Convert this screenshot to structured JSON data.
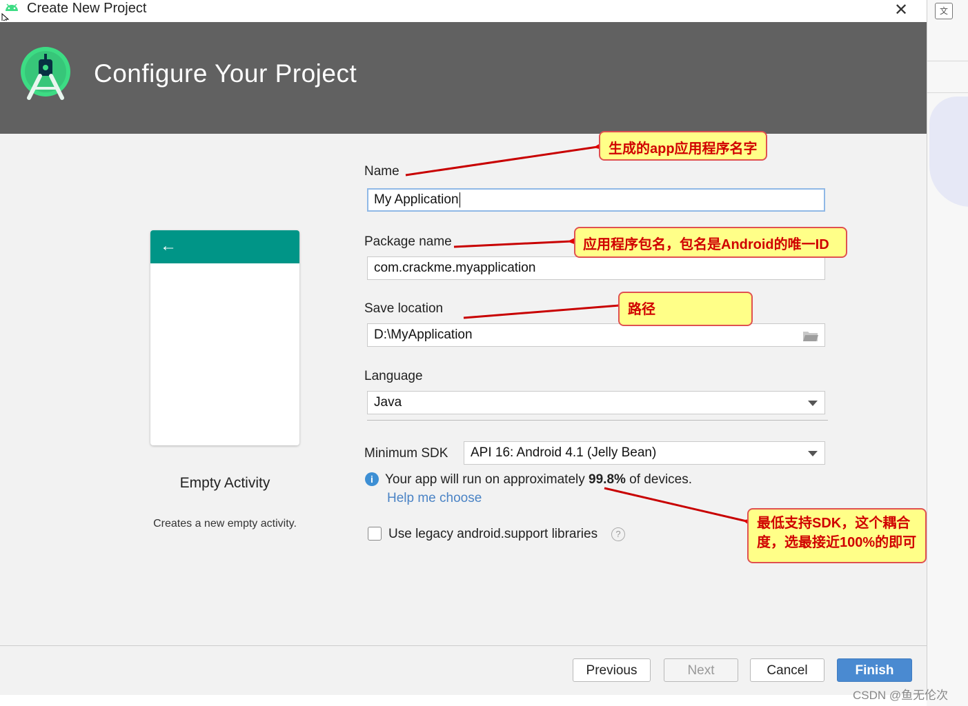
{
  "window": {
    "title": "Create New Project",
    "close_glyph": "✕"
  },
  "header": {
    "heading": "Configure Your Project"
  },
  "template": {
    "back_glyph": "←",
    "name": "Empty Activity",
    "description": "Creates a new empty activity."
  },
  "form": {
    "name_label": "Name",
    "name_value": "My Application",
    "package_label": "Package name",
    "package_value": "com.crackme.myapplication",
    "save_label": "Save location",
    "save_value": "D:\\MyApplication",
    "language_label": "Language",
    "language_value": "Java",
    "min_sdk_label": "Minimum SDK",
    "min_sdk_value": "API 16: Android 4.1 (Jelly Bean)",
    "info_prefix": "Your app will run on approximately ",
    "info_percent": "99.8%",
    "info_suffix": " of devices.",
    "help_link": "Help me choose",
    "legacy_label": "Use legacy android.support libraries",
    "legacy_checked": false,
    "help_glyph": "?"
  },
  "footer": {
    "previous": "Previous",
    "next": "Next",
    "cancel": "Cancel",
    "finish": "Finish"
  },
  "annotations": {
    "name_note": "生成的app应用程序名字",
    "package_note": "应用程序包名，包名是Android的唯一ID",
    "path_note": "路径",
    "sdk_note_line1": "最低支持SDK，这个耦合",
    "sdk_note_line2": "度，选最接近100%的即可"
  },
  "watermark": "CSDN @鱼无伦次",
  "colors": {
    "header_bg": "#616161",
    "toolbar_teal": "#009587",
    "primary_button": "#4a8ad1",
    "link": "#4a83c5",
    "annotation_fill": "#ffff88",
    "annotation_text": "#d00000"
  }
}
